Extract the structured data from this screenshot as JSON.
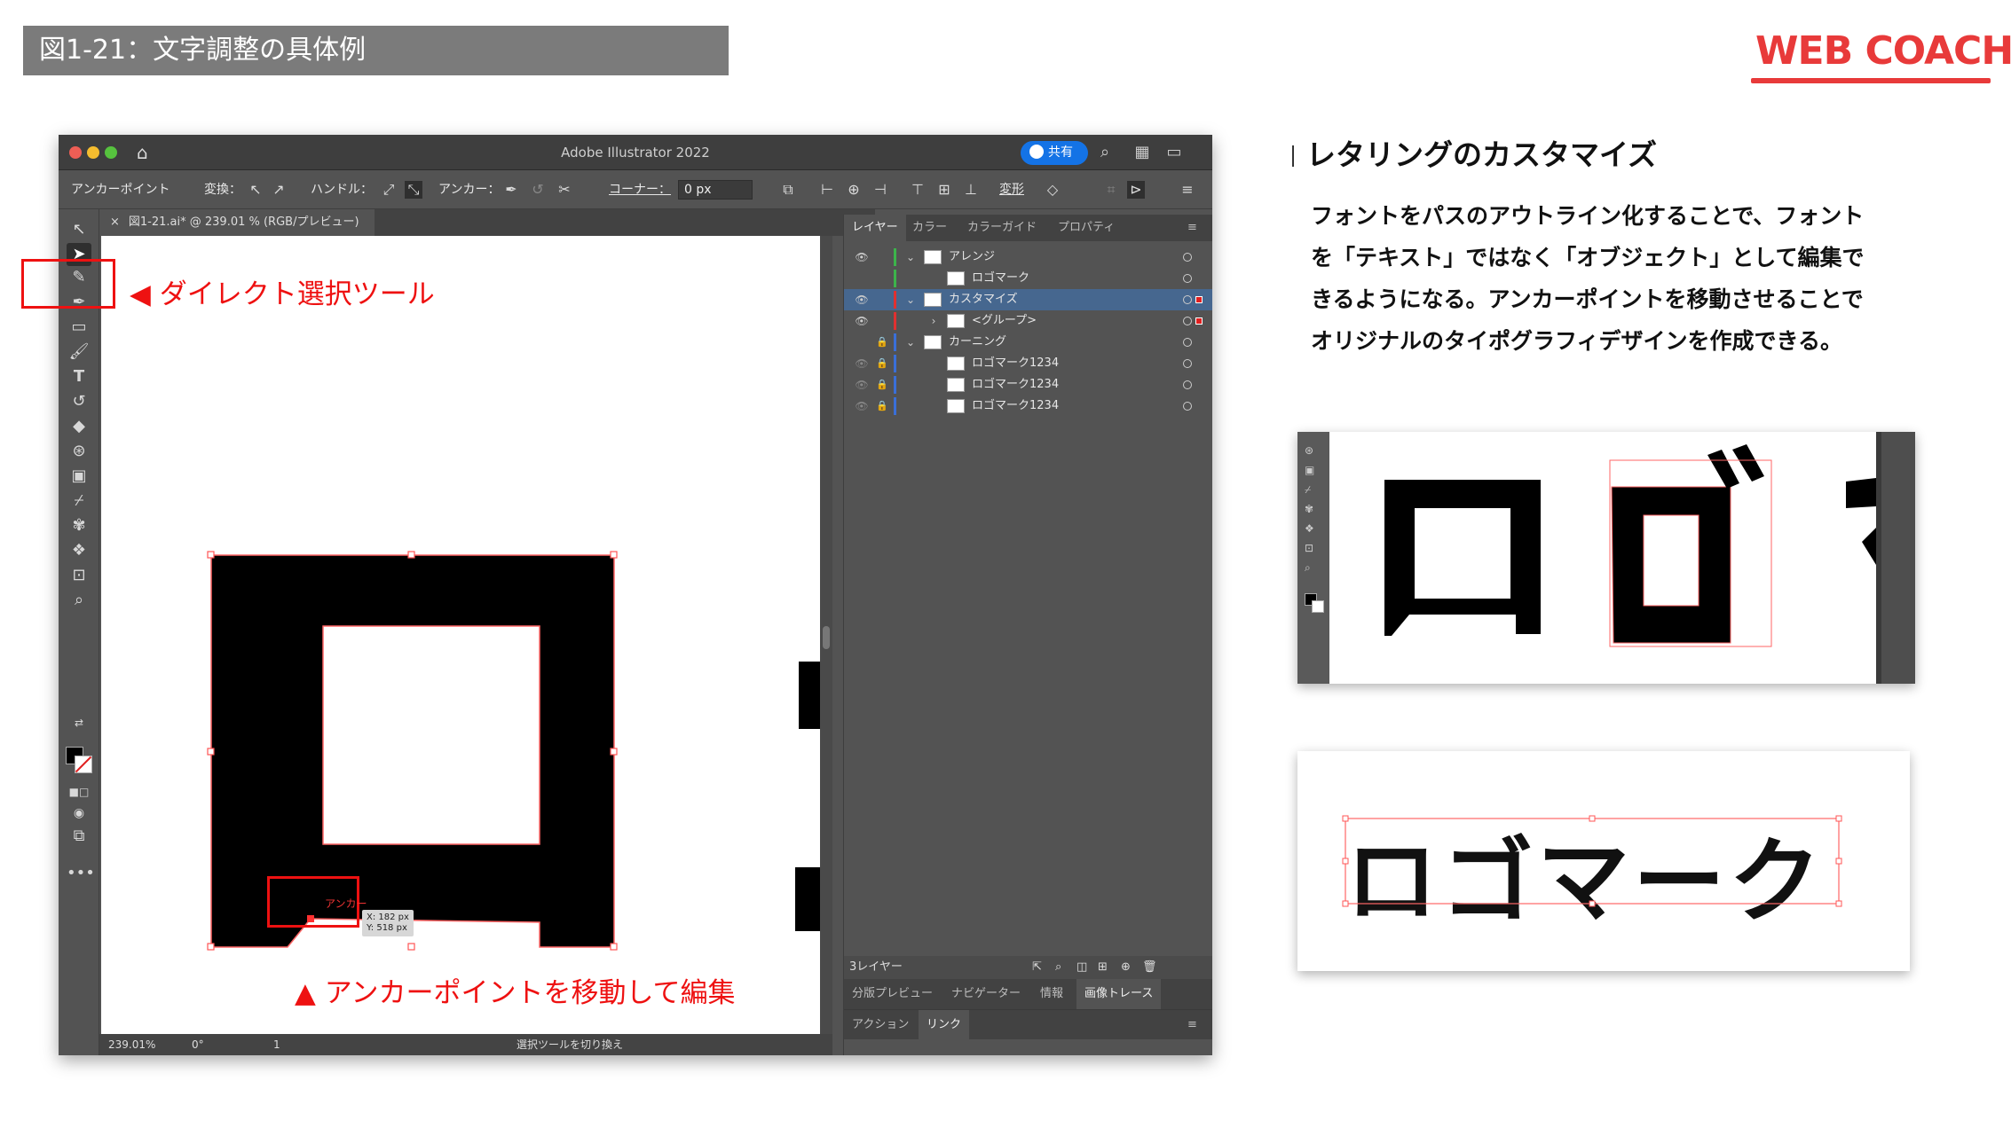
{
  "header": {
    "figure_title": "図1-21：文字調整の具体例",
    "logo_part1": "WEB",
    "logo_part2": "COACH",
    "brand_color": "#e83a3a"
  },
  "app": {
    "window_title": "Adobe Illustrator 2022",
    "share_label": "共有",
    "document_tab": "図1-21.ai* @ 239.01 % (RGB/プレビュー)",
    "close_glyph": "×"
  },
  "controlbar": {
    "tool_name": "アンカーポイント",
    "convert_label": "変換：",
    "handle_label": "ハンドル：",
    "anchor_label": "アンカー：",
    "corner_label": "コーナー：",
    "corner_value": "0 px",
    "transform_label": "変形"
  },
  "layers_panel": {
    "tabs": [
      "レイヤー",
      "カラー",
      "カラーガイド",
      "プロパティ"
    ],
    "rows": [
      {
        "name": "アレンジ"
      },
      {
        "name": "ロゴマーク"
      },
      {
        "name": "カスタマイズ"
      },
      {
        "name": "<グループ>"
      },
      {
        "name": "カーニング"
      },
      {
        "name": "ロゴマーク1234"
      },
      {
        "name": "ロゴマーク1234"
      },
      {
        "name": "ロゴマーク1234"
      }
    ],
    "footer_count": "3レイヤー",
    "lower_tabs": [
      "分版プレビュー",
      "ナビゲーター",
      "情報",
      "画像トレース"
    ],
    "bottom_tabs": [
      "アクション",
      "リンク"
    ]
  },
  "statusbar": {
    "zoom": "239.01%",
    "rotation": "0°",
    "artboard": "1",
    "status_text": "選択ツールを切り換え"
  },
  "annotations": {
    "direct_select": "◀ ダイレクト選択ツール",
    "move_anchor": "▲ アンカーポイントを移動して編集",
    "anchor_tag": "アンカー",
    "readout_x": "X: 182 px",
    "readout_y": "Y: 518 px"
  },
  "right": {
    "section_title": "レタリングのカスタマイズ",
    "body_lines": [
      "フォントをパスのアウトライン化することで、フォント",
      "を「テキスト」ではなく「オブジェクト」として編集で",
      "きるようになる。アンカーポイントを移動させることで",
      "オリジナルのタイポグラフィデザインを作成できる。"
    ],
    "sample_text": "ロゴマーク"
  }
}
